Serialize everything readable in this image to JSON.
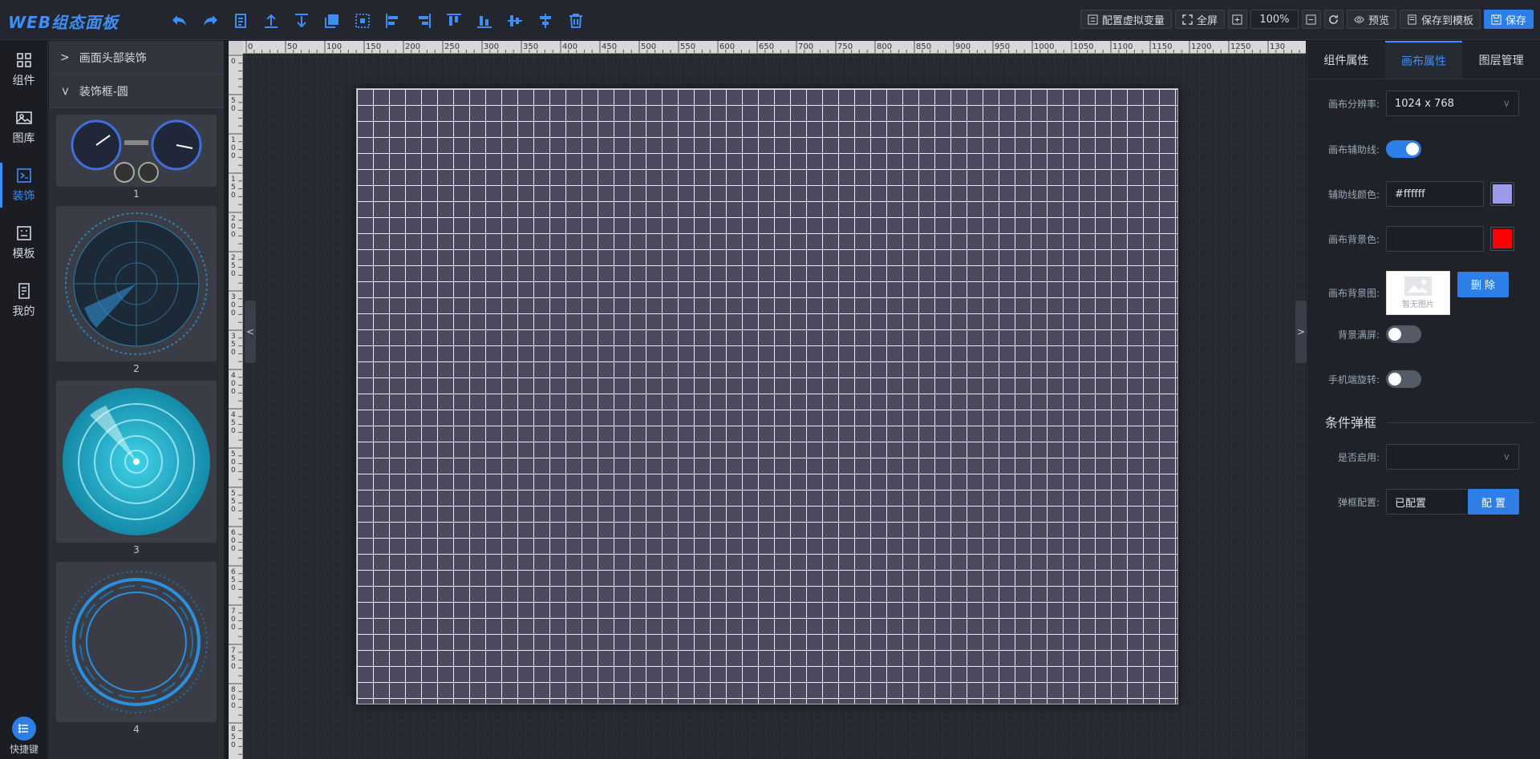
{
  "app": {
    "title": "WEB组态面板"
  },
  "toolbar": {
    "icons": [
      "undo-icon",
      "redo-icon",
      "copy-icon",
      "move-top-icon",
      "move-bottom-icon",
      "group-icon",
      "ungroup-icon",
      "align-left-icon",
      "align-right-icon",
      "align-top-icon",
      "align-bottom-icon",
      "align-center-h-icon",
      "align-center-v-icon",
      "delete-icon"
    ],
    "config_vars": "配置虚拟变量",
    "fullscreen": "全屏",
    "zoom": "100%",
    "preview": "预览",
    "save_template": "保存到模板",
    "save": "保存"
  },
  "sidebar": {
    "items": [
      {
        "label": "组件",
        "icon": "grid-icon"
      },
      {
        "label": "图库",
        "icon": "image-icon"
      },
      {
        "label": "装饰",
        "icon": "decoration-icon",
        "active": true
      },
      {
        "label": "模板",
        "icon": "template-icon"
      },
      {
        "label": "我的",
        "icon": "mine-icon"
      }
    ],
    "shortcut": "快捷键"
  },
  "panel": {
    "groups": [
      {
        "title": "画面头部装饰",
        "expanded": false
      },
      {
        "title": "装饰框-圆",
        "expanded": true
      }
    ],
    "thumbs": [
      "1",
      "2",
      "3",
      "4"
    ]
  },
  "ruler": {
    "top": [
      "0",
      "50",
      "100",
      "150",
      "200",
      "250",
      "300",
      "350",
      "400",
      "450",
      "500",
      "550",
      "600",
      "650",
      "700",
      "750",
      "800",
      "850",
      "900",
      "950",
      "1000",
      "1050",
      "1100",
      "1150",
      "1200",
      "1250",
      "130"
    ],
    "left": [
      "0",
      "50",
      "100",
      "150",
      "200",
      "250",
      "300",
      "350",
      "400",
      "450",
      "500",
      "550",
      "600",
      "650",
      "700",
      "750",
      "800",
      "850"
    ]
  },
  "right": {
    "tabs": [
      "组件属性",
      "画布属性",
      "图层管理"
    ],
    "active_tab": 1,
    "resolution_label": "画布分辨率:",
    "resolution_value": "1024 x 768",
    "guide_label": "画布辅助线:",
    "guide_on": true,
    "guide_color_label": "辅助线颜色:",
    "guide_color_value": "#ffffff",
    "guide_swatch": "#9b9be8",
    "bg_color_label": "画布背景色:",
    "bg_color_value": "",
    "bg_swatch": "#ff0000",
    "bg_image_label": "画布背景图:",
    "no_image": "暂无图片",
    "delete_btn": "删 除",
    "bg_full_label": "背景满屏:",
    "bg_full_on": false,
    "mobile_rotate_label": "手机端旋转:",
    "mobile_rotate_on": false,
    "section_title": "条件弹框",
    "enabled_label": "是否启用:",
    "enabled_value": "",
    "popup_label": "弹框配置:",
    "popup_value": "已配置",
    "popup_btn": "配 置"
  },
  "colors": {
    "accent": "#3f8ef7",
    "canvas_bg": "#4b4a5e",
    "grid_line": "#e8e8f2"
  }
}
